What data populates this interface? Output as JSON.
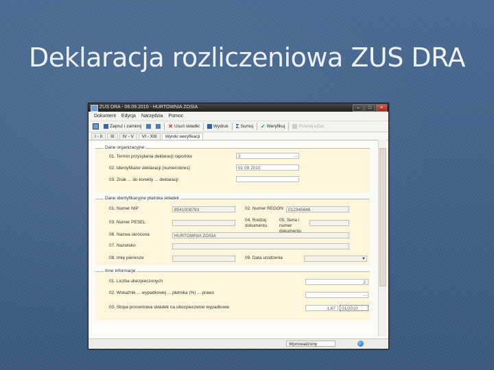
{
  "slide": {
    "title": "Deklaracja rozliczeniowa ZUS DRA"
  },
  "window": {
    "title": "ZUS DRA - 06.09.2010 - HURTOWNIA ZOSIA",
    "controls": {
      "minimize": "–",
      "maximize": "□",
      "close": "×"
    }
  },
  "menu": [
    "Dokument",
    "Edycja",
    "Narzędzia",
    "Pomoc"
  ],
  "toolbar": {
    "save_close": "Zapisz i zamknij",
    "delete_components": "Usuń składki",
    "print": "Wydruk",
    "sum": "Sumuj",
    "verify": "Weryfikuj",
    "send": "Prześlij eZus"
  },
  "tabs": [
    "I - II",
    "III",
    "IV - V",
    "VI - XIII",
    "Wyniki weryfikacji"
  ],
  "sections": {
    "s1": {
      "header": "Dane organizacyjne",
      "rows": [
        {
          "label": "01. Termin przysyłania deklaracji raportów",
          "value": "2"
        },
        {
          "label": "02. Identyfikator deklaracji (numer/okres)",
          "value": "01 09 2010"
        },
        {
          "label": "03. Znak ... do korekty ... deklaracji",
          "value": ""
        }
      ]
    },
    "s2": {
      "header": "Dane identyfikacyjne płatnika składek",
      "nip_label": "01. Numer NIP",
      "nip_value": "8541008793",
      "regon_label": "02. Numer REGON",
      "regon_value": "012345646",
      "pesel_label": "03. Numer PESEL",
      "doc_label": "04. Rodzaj dokumentu",
      "doc_series_label": "05. Seria i numer dokumentu",
      "short_name_label": "06. Nazwa skrócona",
      "short_name_value": "HURTOWNIA ZOSIA",
      "surname_label": "07. Nazwisko",
      "firstname_label": "08. Imię pierwsze",
      "birthdate_label": "09. Data urodzenia"
    },
    "s3": {
      "header": "Inne informacje",
      "rows": [
        {
          "label": "01. Liczba ubezpieczonych",
          "value": "2"
        },
        {
          "label": "02. Wskaźnik ... wypadkowej ... płatnika (%) ... prawo",
          "value": ""
        },
        {
          "label": "03. Stopa procentowa składek na ubezpieczenie wypadkowe",
          "value": "1,67",
          "value2": "01/2010"
        }
      ]
    }
  },
  "status": {
    "text": "Wprowadzony"
  },
  "colors": {
    "background": "#3f5f86",
    "panel": "#fdf5dc",
    "titlebar": "#2a2a2a"
  }
}
